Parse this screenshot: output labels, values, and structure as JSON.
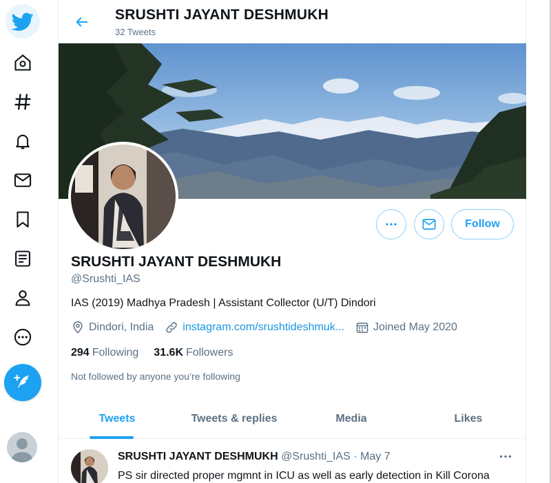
{
  "nav": {
    "items": [
      "twitter-logo",
      "home-icon",
      "explore-hashtag-icon",
      "notifications-bell-icon",
      "messages-envelope-icon",
      "bookmarks-icon",
      "lists-icon",
      "profile-person-icon",
      "more-circle-icon"
    ],
    "tweet_button_icon": "feather-plus-icon"
  },
  "header": {
    "title": "SRUSHTI JAYANT DESHMUKH",
    "subtitle": "32 Tweets"
  },
  "profile": {
    "name": "SRUSHTI JAYANT DESHMUKH",
    "handle": "@Srushti_IAS",
    "bio": "IAS (2019) Madhya Pradesh | Assistant Collector (U/T) Dindori",
    "location": "Dindori, India",
    "website": "instagram.com/srushtideshmuk...",
    "joined": "Joined May 2020",
    "following_count": "294",
    "following_label": "Following",
    "followers_count": "31.6K",
    "followers_label": "Followers",
    "note": "Not followed by anyone you’re following",
    "follow_label": "Follow"
  },
  "tabs": [
    {
      "label": "Tweets",
      "active": true
    },
    {
      "label": "Tweets & replies",
      "active": false
    },
    {
      "label": "Media",
      "active": false
    },
    {
      "label": "Likes",
      "active": false
    }
  ],
  "tweet": {
    "author": "SRUSHTI JAYANT DESHMUKH",
    "meta": " @Srushti_IAS · May 7",
    "text": "PS sir directed proper mgmnt in ICU as well as early detection in Kill Corona"
  },
  "colors": {
    "accent": "#1da1f2",
    "text": "#0f1419",
    "muted": "#5b7083",
    "link": "#1b95e0"
  }
}
